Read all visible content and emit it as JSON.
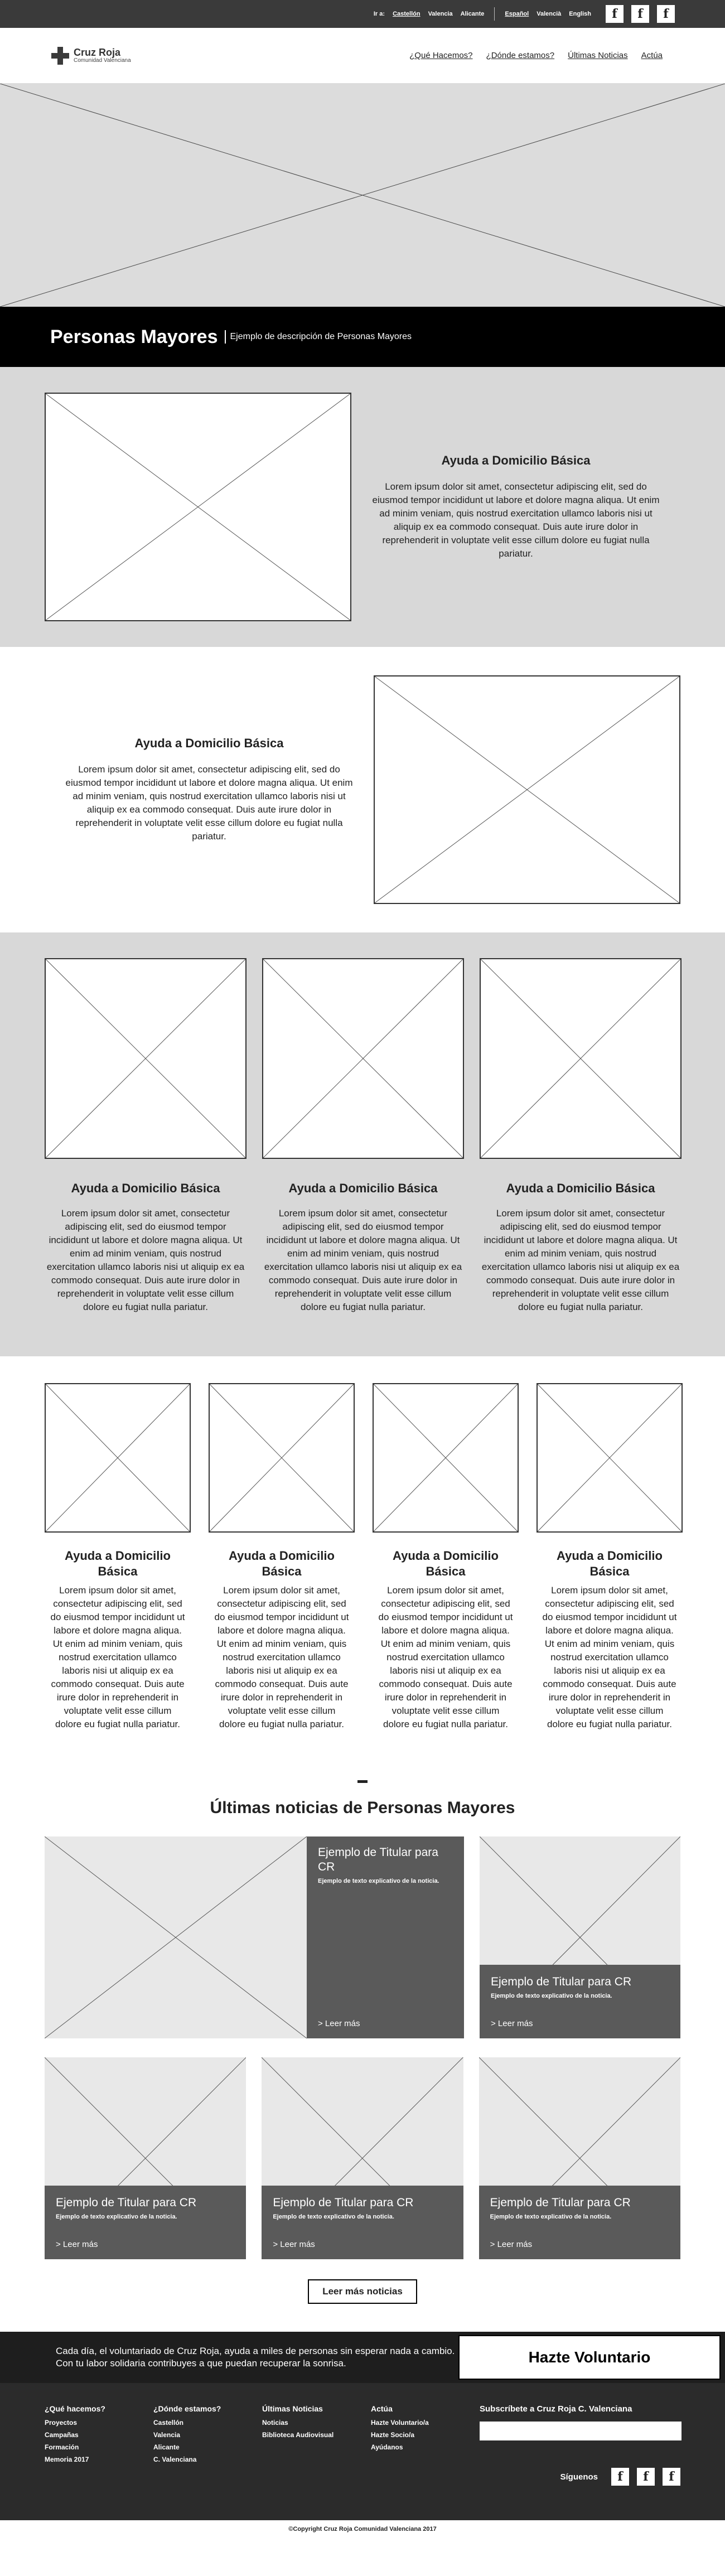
{
  "topbar": {
    "ir_a": "Ir a:",
    "cities": [
      "Castellón",
      "Valencia",
      "Alicante"
    ],
    "languages": [
      "Español",
      "Valencià",
      "English"
    ],
    "social": [
      "f",
      "f",
      "f"
    ],
    "social_icon": "facebook-icon"
  },
  "header": {
    "logo_title": "Cruz Roja",
    "logo_sub": "Comunidad Valenciana",
    "nav": [
      "¿Qué Hacemos?",
      "¿Dónde estamos?",
      "Últimas Noticias",
      "Actúa"
    ]
  },
  "title": {
    "heading": "Personas Mayores",
    "description": "Ejemplo de descripción de Personas Mayores"
  },
  "features": [
    {
      "title": "Ayuda a Domicilio Básica",
      "body": "Lorem ipsum dolor sit amet, consectetur adipiscing elit, sed do eiusmod tempor incididunt ut labore et dolore magna aliqua. Ut enim ad minim veniam, quis nostrud exercitation ullamco laboris nisi ut aliquip ex ea commodo consequat. Duis aute irure dolor in reprehenderit in voluptate velit esse cillum dolore eu fugiat nulla pariatur."
    },
    {
      "title": "Ayuda a Domicilio Básica",
      "body": "Lorem ipsum dolor sit amet, consectetur adipiscing elit, sed do eiusmod tempor incididunt ut labore et dolore magna aliqua. Ut enim ad minim veniam, quis nostrud exercitation ullamco laboris nisi ut aliquip ex ea commodo consequat. Duis aute irure dolor in reprehenderit in voluptate velit esse cillum dolore eu fugiat nulla pariatur."
    }
  ],
  "three_cols": [
    {
      "title": "Ayuda a Domicilio Básica",
      "body": "Lorem ipsum dolor sit amet, consectetur adipiscing elit, sed do eiusmod tempor incididunt ut labore et dolore magna aliqua. Ut enim ad minim veniam, quis nostrud exercitation ullamco laboris nisi ut aliquip ex ea commodo consequat. Duis aute irure dolor in reprehenderit in voluptate velit esse cillum dolore eu fugiat nulla pariatur."
    },
    {
      "title": "Ayuda a Domicilio Básica",
      "body": "Lorem ipsum dolor sit amet, consectetur adipiscing elit, sed do eiusmod tempor incididunt ut labore et dolore magna aliqua. Ut enim ad minim veniam, quis nostrud exercitation ullamco laboris nisi ut aliquip ex ea commodo consequat. Duis aute irure dolor in reprehenderit in voluptate velit esse cillum dolore eu fugiat nulla pariatur."
    },
    {
      "title": "Ayuda a Domicilio Básica",
      "body": "Lorem ipsum dolor sit amet, consectetur adipiscing elit, sed do eiusmod tempor incididunt ut labore et dolore magna aliqua. Ut enim ad minim veniam, quis nostrud exercitation ullamco laboris nisi ut aliquip ex ea commodo consequat. Duis aute irure dolor in reprehenderit in voluptate velit esse cillum dolore eu fugiat nulla pariatur."
    }
  ],
  "four_cols": [
    {
      "title": "Ayuda a Domicilio Básica",
      "body": "Lorem ipsum dolor sit amet, consectetur adipiscing elit, sed do eiusmod tempor incididunt ut labore et dolore magna aliqua. Ut enim ad minim veniam, quis nostrud exercitation ullamco laboris nisi ut aliquip ex ea commodo consequat. Duis aute irure dolor in reprehenderit in voluptate velit esse cillum dolore eu fugiat nulla pariatur."
    },
    {
      "title": "Ayuda a Domicilio Básica",
      "body": "Lorem ipsum dolor sit amet, consectetur adipiscing elit, sed do eiusmod tempor incididunt ut labore et dolore magna aliqua. Ut enim ad minim veniam, quis nostrud exercitation ullamco laboris nisi ut aliquip ex ea commodo consequat. Duis aute irure dolor in reprehenderit in voluptate velit esse cillum dolore eu fugiat nulla pariatur."
    },
    {
      "title": "Ayuda a Domicilio Básica",
      "body": "Lorem ipsum dolor sit amet, consectetur adipiscing elit, sed do eiusmod tempor incididunt ut labore et dolore magna aliqua. Ut enim ad minim veniam, quis nostrud exercitation ullamco laboris nisi ut aliquip ex ea commodo consequat. Duis aute irure dolor in reprehenderit in voluptate velit esse cillum dolore eu fugiat nulla pariatur."
    },
    {
      "title": "Ayuda a Domicilio Básica",
      "body": "Lorem ipsum dolor sit amet, consectetur adipiscing elit, sed do eiusmod tempor incididunt ut labore et dolore magna aliqua. Ut enim ad minim veniam, quis nostrud exercitation ullamco laboris nisi ut aliquip ex ea commodo consequat. Duis aute irure dolor in reprehenderit in voluptate velit esse cillum dolore eu fugiat nulla pariatur."
    }
  ],
  "news": {
    "heading": "Últimas noticias de Personas Mayores",
    "featured": {
      "title": "Ejemplo de Titular para CR",
      "desc": "Ejemplo de texto explicativo de la noticia.",
      "more": "> Leer más"
    },
    "cards": [
      {
        "title": "Ejemplo de Titular para CR",
        "desc": "Ejemplo de texto explicativo de la noticia.",
        "more": "> Leer más"
      },
      {
        "title": "Ejemplo de Titular para CR",
        "desc": "Ejemplo de texto explicativo de la noticia.",
        "more": "> Leer más"
      },
      {
        "title": "Ejemplo de Titular para CR",
        "desc": "Ejemplo de texto explicativo de la noticia.",
        "more": "> Leer más"
      },
      {
        "title": "Ejemplo de Titular para CR",
        "desc": "Ejemplo de texto explicativo de la noticia.",
        "more": "> Leer más"
      }
    ],
    "more_button": "Leer más noticias"
  },
  "cta": {
    "line1": "Cada día, el voluntariado de Cruz Roja, ayuda a miles de personas sin esperar nada a cambio.",
    "line2": "Con tu labor solidaria contribuyes a que puedan recuperar la sonrisa.",
    "button": "Hazte Voluntario"
  },
  "footer": {
    "columns": [
      {
        "heading": "¿Qué hacemos?",
        "items": [
          "Proyectos",
          "Campañas",
          "Formación",
          "Memoria 2017"
        ]
      },
      {
        "heading": "¿Dónde estamos?",
        "items": [
          "Castellón",
          "Valencia",
          "Alicante",
          "C. Valenciana"
        ]
      },
      {
        "heading": "Últimas Noticias",
        "items": [
          "Noticias",
          "Biblioteca Audiovisual"
        ]
      },
      {
        "heading": "Actúa",
        "items": [
          "Hazte Voluntario/a",
          "Hazte Socio/a",
          "Ayúdanos"
        ]
      }
    ],
    "subscribe": "Subscríbete a Cruz Roja C. Valenciana",
    "follow": "Síguenos",
    "social": [
      "f",
      "f",
      "f"
    ],
    "social_icon": "facebook-icon"
  },
  "copyright": "©Copyright Cruz Roja Comunidad Valenciana 2017"
}
